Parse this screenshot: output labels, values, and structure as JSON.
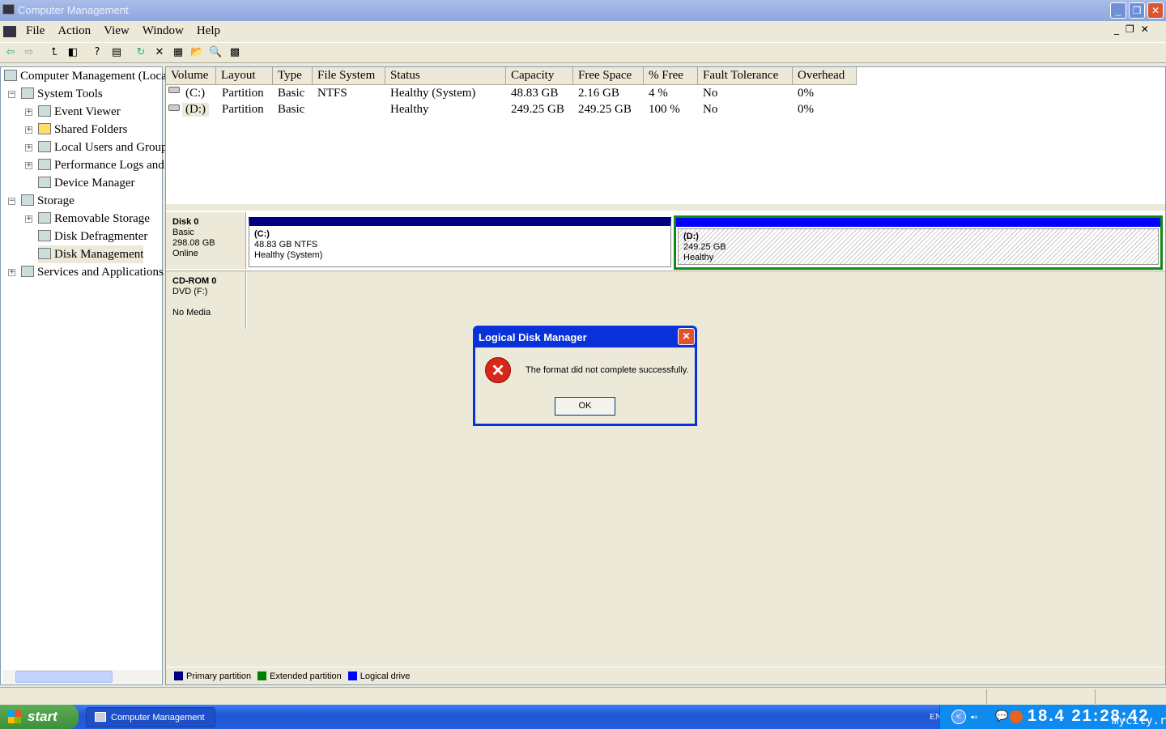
{
  "window": {
    "title": "Computer Management"
  },
  "menu": [
    "File",
    "Action",
    "View",
    "Window",
    "Help"
  ],
  "tree": [
    {
      "label": "Computer Management (Local)"
    },
    {
      "label": "System Tools"
    },
    {
      "label": "Event Viewer"
    },
    {
      "label": "Shared Folders"
    },
    {
      "label": "Local Users and Groups"
    },
    {
      "label": "Performance Logs and Alerts"
    },
    {
      "label": "Device Manager"
    },
    {
      "label": "Storage"
    },
    {
      "label": "Removable Storage"
    },
    {
      "label": "Disk Defragmenter"
    },
    {
      "label": "Disk Management"
    },
    {
      "label": "Services and Applications"
    }
  ],
  "columns": [
    "Volume",
    "Layout",
    "Type",
    "File System",
    "Status",
    "Capacity",
    "Free Space",
    "% Free",
    "Fault Tolerance",
    "Overhead"
  ],
  "rows": [
    [
      "(C:)",
      "Partition",
      "Basic",
      "NTFS",
      "Healthy (System)",
      "48.83 GB",
      "2.16 GB",
      "4 %",
      "No",
      "0%"
    ],
    [
      "(D:)",
      "Partition",
      "Basic",
      "",
      "Healthy",
      "249.25 GB",
      "249.25 GB",
      "100 %",
      "No",
      "0%"
    ]
  ],
  "disks": {
    "disk0": {
      "name": "Disk 0",
      "type": "Basic",
      "size": "298.08 GB",
      "state": "Online",
      "c": {
        "name": "(C:)",
        "info": "48.83 GB NTFS",
        "status": "Healthy (System)"
      },
      "d": {
        "name": "(D:)",
        "info": "249.25 GB",
        "status": "Healthy"
      }
    },
    "cdrom": {
      "name": "CD-ROM 0",
      "type": "DVD (F:)",
      "state": "No Media"
    }
  },
  "legend": [
    "Primary partition",
    "Extended partition",
    "Logical drive"
  ],
  "colors": {
    "primary": "#000080",
    "extended": "#008000",
    "logical": "#0000ff"
  },
  "dialog": {
    "title": "Logical Disk Manager",
    "message": "The format did not complete successfully.",
    "ok": "OK"
  },
  "taskbar": {
    "start": "start",
    "task": "Computer Management",
    "lang": "EN",
    "clock": "18.4 21:28:42",
    "watermark": "mycity.rs"
  }
}
